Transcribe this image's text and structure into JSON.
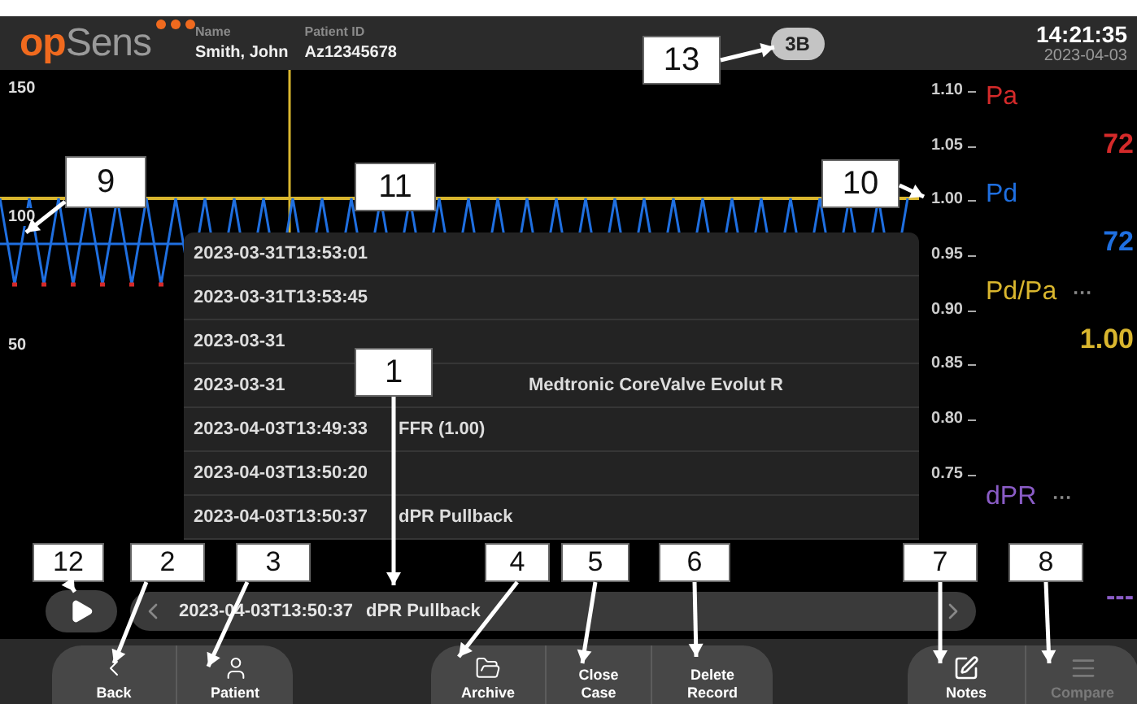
{
  "header": {
    "logo": {
      "part_1": "op",
      "part_2": "Sens"
    },
    "patient_name": {
      "label": "Name",
      "value": "Smith, John"
    },
    "patient_id": {
      "label": "Patient ID",
      "value": "Az12345678"
    },
    "badge": "3B",
    "time": "14:21:35",
    "date": "2023-04-03"
  },
  "chart": {
    "left_ticks": [
      "150",
      "100",
      "50"
    ],
    "right_ticks": [
      "1.10",
      "1.05",
      "1.00",
      "0.95",
      "0.90",
      "0.85",
      "0.80",
      "0.75"
    ]
  },
  "legend": [
    {
      "name": "Pa",
      "color": "#d42a2a",
      "value": "72"
    },
    {
      "name": "Pd",
      "color": "#1f6fe0",
      "value": "72"
    },
    {
      "name": "Pd/Pa",
      "color": "#d9b62e",
      "status": "···",
      "value": "1.00"
    },
    {
      "name": "dPR",
      "color": "#8a5cc6",
      "status": "···",
      "value": "---"
    }
  ],
  "records": [
    {
      "time": "2023-03-31T13:53:01"
    },
    {
      "time": "2023-03-31T13:53:45"
    },
    {
      "time": "2023-03-31"
    },
    {
      "time": "2023-03-31",
      "device": "Medtronic CoreValve Evolut R"
    },
    {
      "time": "2023-04-03T13:49:33",
      "label": "FFR (1.00)"
    },
    {
      "time": "2023-04-03T13:50:20"
    },
    {
      "time": "2023-04-03T13:50:37",
      "label": "dPR Pullback"
    }
  ],
  "selection": {
    "time": "2023-04-03T13:50:37",
    "label": "dPR Pullback"
  },
  "toolbar": [
    [
      {
        "kind": "back",
        "label": "Back",
        "disabled": false
      },
      {
        "kind": "patient",
        "label": "Patient",
        "disabled": false
      }
    ],
    [
      {
        "kind": "archive",
        "label": "Archive",
        "disabled": false
      },
      {
        "kind": "text",
        "label": "Close Case",
        "disabled": false
      },
      {
        "kind": "text",
        "label": "Delete Record",
        "disabled": false
      }
    ],
    [
      {
        "kind": "notes",
        "label": "Notes",
        "disabled": false
      },
      {
        "kind": "compare",
        "label": "Compare",
        "disabled": true
      }
    ]
  ],
  "callouts": [
    {
      "label": "13"
    },
    {
      "label": "9"
    },
    {
      "label": "11"
    },
    {
      "label": "10"
    },
    {
      "label": "1"
    },
    {
      "label": "12"
    },
    {
      "label": "2"
    },
    {
      "label": "3"
    },
    {
      "label": "4"
    },
    {
      "label": "5"
    },
    {
      "label": "6"
    },
    {
      "label": "7"
    },
    {
      "label": "8"
    }
  ]
}
